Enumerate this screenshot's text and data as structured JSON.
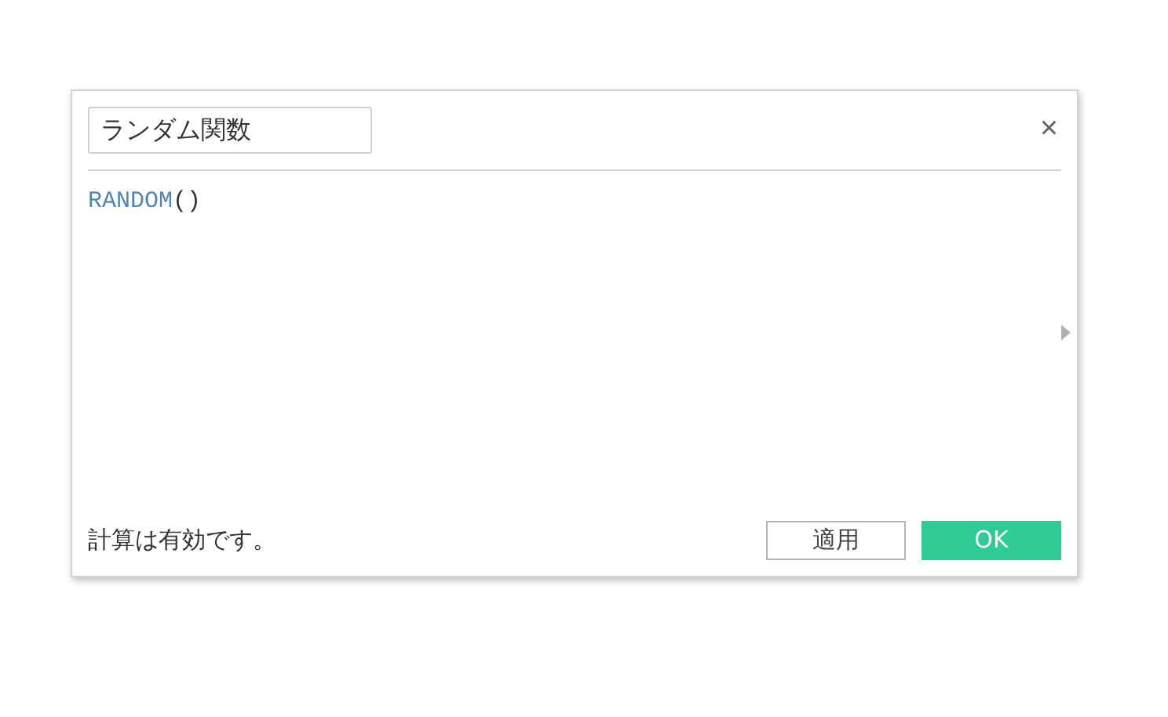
{
  "dialog": {
    "name_field": {
      "value": "ランダム関数"
    },
    "close": "×",
    "formula": [
      {
        "kind": "function",
        "text": "RANDOM"
      },
      {
        "kind": "punctuation",
        "text": "()"
      }
    ],
    "status": "計算は有効です。",
    "buttons": [
      {
        "kind": "secondary",
        "label": "適用"
      },
      {
        "kind": "primary",
        "label": "OK"
      }
    ]
  }
}
